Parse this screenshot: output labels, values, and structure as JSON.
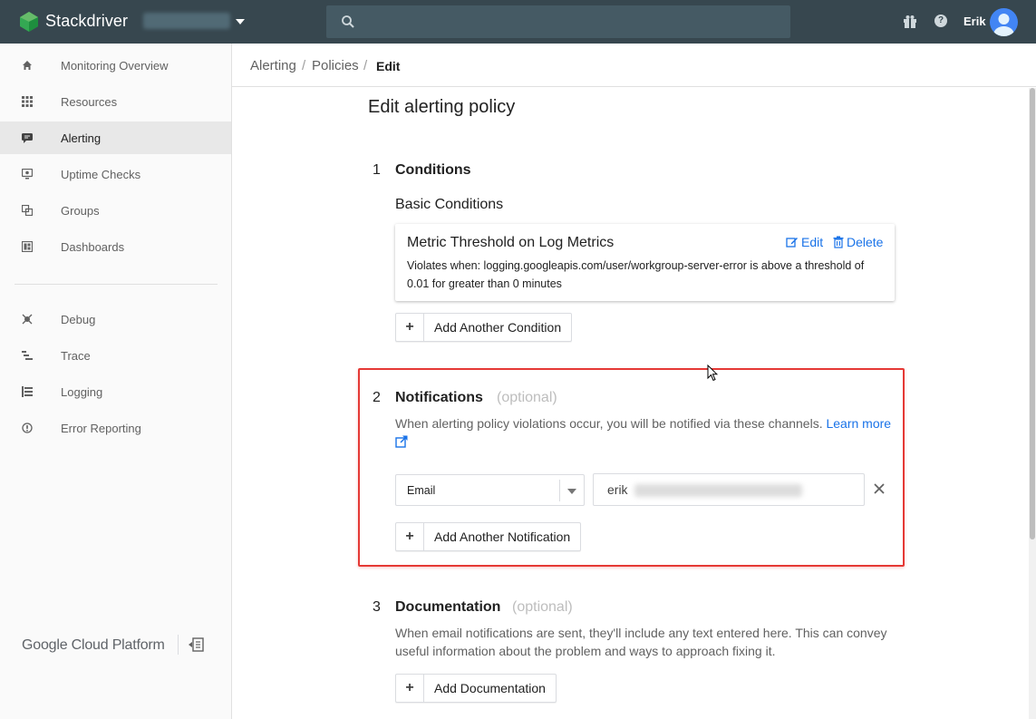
{
  "app": {
    "brand": "Stackdriver",
    "user_name": "Erik"
  },
  "sidebar": {
    "items": [
      {
        "label": "Monitoring Overview",
        "icon": "home-icon"
      },
      {
        "label": "Resources",
        "icon": "grid-icon"
      },
      {
        "label": "Alerting",
        "icon": "alert-icon",
        "active": true
      },
      {
        "label": "Uptime Checks",
        "icon": "monitor-icon"
      },
      {
        "label": "Groups",
        "icon": "groups-icon"
      },
      {
        "label": "Dashboards",
        "icon": "dashboard-icon"
      },
      {
        "label": "Debug",
        "icon": "debug-icon"
      },
      {
        "label": "Trace",
        "icon": "trace-icon"
      },
      {
        "label": "Logging",
        "icon": "logging-icon"
      },
      {
        "label": "Error Reporting",
        "icon": "error-reporting-icon"
      }
    ],
    "footer_logo": "Google Cloud Platform"
  },
  "breadcrumb": {
    "items": [
      "Alerting",
      "Policies",
      "Edit"
    ],
    "separator": "/"
  },
  "main": {
    "title": "Edit alerting policy",
    "conditions": {
      "number": "1",
      "title": "Conditions",
      "subhead": "Basic Conditions",
      "card": {
        "title": "Metric Threshold on Log Metrics",
        "edit_label": "Edit",
        "delete_label": "Delete",
        "description": "Violates when: logging.googleapis.com/user/workgroup-server-error is above a threshold of 0.01 for greater than 0 minutes"
      },
      "add_button": "Add Another Condition"
    },
    "notifications": {
      "number": "2",
      "title": "Notifications",
      "optional": "(optional)",
      "description": "When alerting policy violations occur, you will be notified via these channels.",
      "learn_more": "Learn more",
      "channel_type": "Email",
      "email_value": "erik",
      "add_button": "Add Another Notification"
    },
    "documentation": {
      "number": "3",
      "title": "Documentation",
      "optional": "(optional)",
      "description": "When email notifications are sent, they'll include any text entered here. This can convey useful information about the problem and ways to approach fixing it.",
      "add_button": "Add Documentation"
    }
  },
  "colors": {
    "topbar": "#37474f",
    "link": "#1a73e8",
    "highlight": "#e53935",
    "active_nav": "#e8e8e8"
  }
}
